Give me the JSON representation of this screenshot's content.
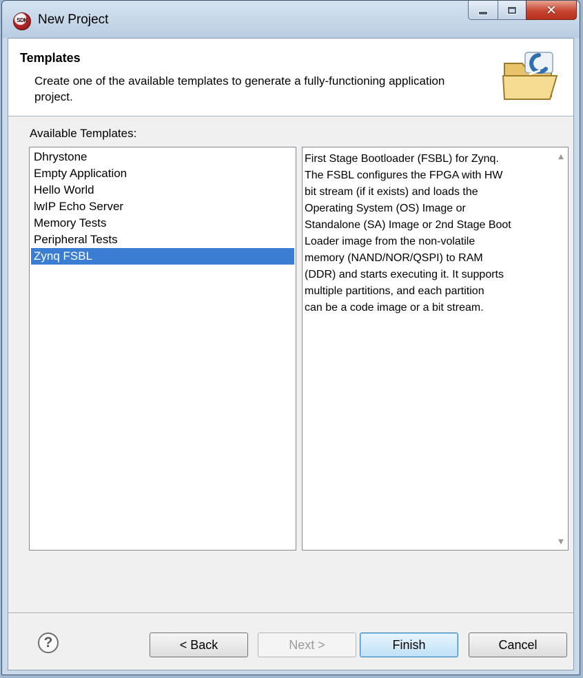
{
  "window": {
    "title": "New Project",
    "app_icon_text": "SDK"
  },
  "header": {
    "title": "Templates",
    "description": "Create one of the available templates to generate a fully-functioning application project."
  },
  "templates": {
    "label": "Available Templates:",
    "items": [
      {
        "label": "Dhrystone",
        "selected": false
      },
      {
        "label": "Empty Application",
        "selected": false
      },
      {
        "label": "Hello World",
        "selected": false
      },
      {
        "label": "lwIP Echo Server",
        "selected": false
      },
      {
        "label": "Memory Tests",
        "selected": false
      },
      {
        "label": "Peripheral Tests",
        "selected": false
      },
      {
        "label": "Zynq FSBL",
        "selected": true
      }
    ],
    "description": "First Stage Bootloader (FSBL) for Zynq.\nThe FSBL configures the FPGA with HW\nbit stream (if it exists)  and loads the\nOperating System (OS) Image or\nStandalone (SA) Image or 2nd Stage Boot\nLoader image from the  non-volatile\nmemory (NAND/NOR/QSPI) to RAM\n(DDR) and starts executing it.  It supports\nmultiple partitions,  and each partition\ncan be a code image or a bit stream."
  },
  "buttons": {
    "back": "< Back",
    "next": "Next >",
    "finish": "Finish",
    "cancel": "Cancel",
    "help_glyph": "?"
  },
  "colors": {
    "selection": "#3b7dd3",
    "close_button": "#c74631"
  }
}
